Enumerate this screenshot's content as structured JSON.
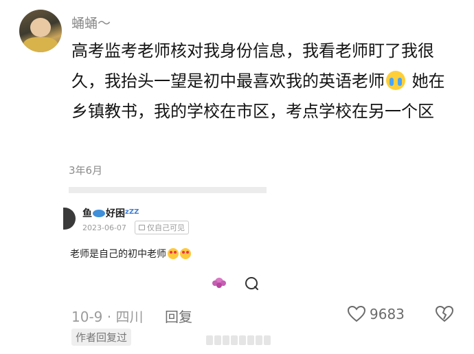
{
  "comment": {
    "username": "蛹蛹～",
    "text_part1": "高考监考老师核对我身份信息，我看老师盯了我很久，我抬头一望是初中最喜欢我的英语老师",
    "emoji": "loudly-crying-face",
    "text_part2": " 她在乡镇教书，我的学校在市区，考点学校在另一个区"
  },
  "embedded_post": {
    "date_header": "3年6月",
    "author": "鱼",
    "author_suffix": "好困",
    "zzz": "zZZ",
    "date": "2023-06-07",
    "privacy": "仅自己可见",
    "text": "老师是自己的初中老师",
    "emojis": [
      "heart-eyes-face",
      "heart-eyes-face"
    ]
  },
  "meta": {
    "time_location": "10-9 · 四川",
    "reply_label": "回复",
    "like_count": "9683",
    "author_replied": "作者回复过"
  },
  "colors": {
    "primary_text": "#141414",
    "secondary_text": "#8a8a8a",
    "separator": "#ececec"
  }
}
